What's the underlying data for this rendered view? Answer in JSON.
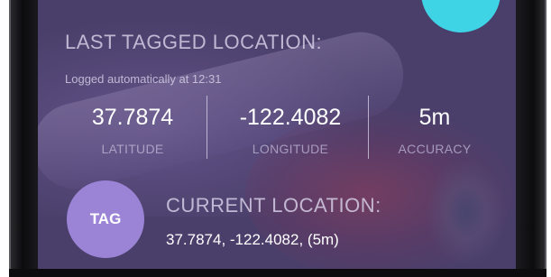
{
  "last_tagged": {
    "heading": "LAST TAGGED LOCATION:",
    "logged_text": "Logged automatically at 12:31",
    "latitude": {
      "value": "37.7874",
      "label": "LATITUDE"
    },
    "longitude": {
      "value": "-122.4082",
      "label": "LONGITUDE"
    },
    "accuracy": {
      "value": "5m",
      "label": "ACCURACY"
    }
  },
  "tag_button": {
    "label": "TAG"
  },
  "current_location": {
    "heading": "CURRENT LOCATION:",
    "coordinates": "37.7874, -122.4082, (5m)"
  },
  "colors": {
    "background": "#4a3f6b",
    "tag_button": "#9b84d6",
    "accent_dot": "#3fd3e6",
    "text_primary": "#ffffff"
  }
}
